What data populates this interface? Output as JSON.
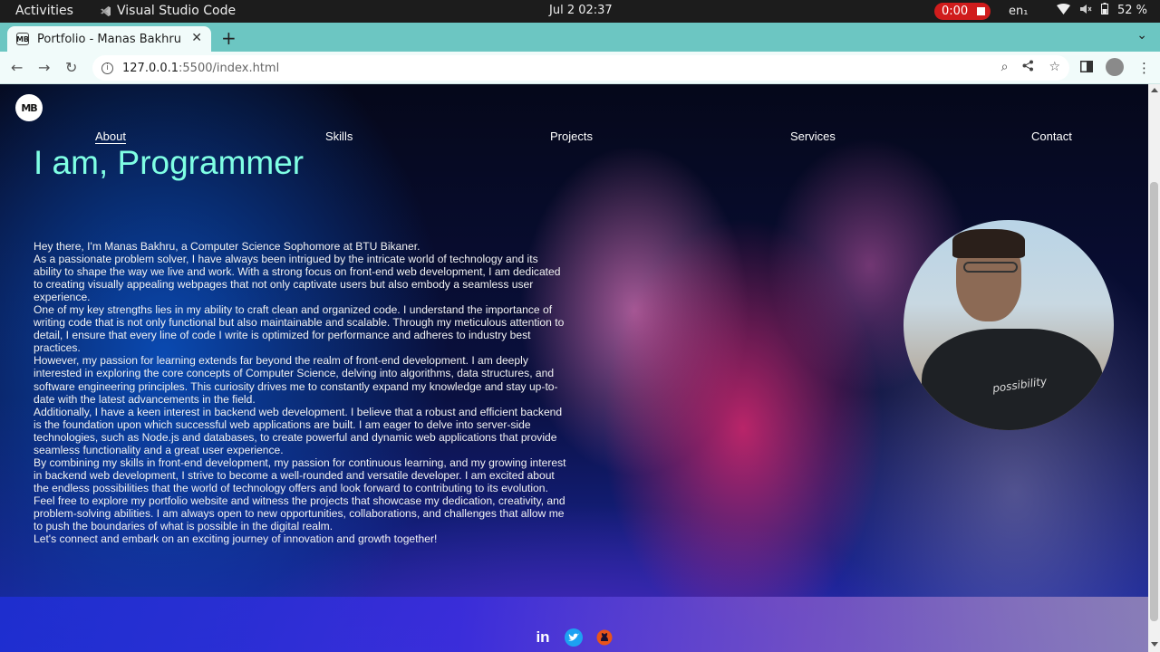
{
  "os_bar": {
    "activities": "Activities",
    "app_name": "Visual Studio Code",
    "clock": "Jul 2  02:37",
    "recording_time": "0:00",
    "language": "en₁",
    "battery": "52 %"
  },
  "browser": {
    "tab_title": "Portfolio - Manas Bakhru",
    "new_tab": "+",
    "url_host": "127.0.0.1",
    "url_rest": ":5500/index.html"
  },
  "page": {
    "logo_text": "MB",
    "nav": [
      "About",
      "Skills",
      "Projects",
      "Services",
      "Contact"
    ],
    "active_nav": "About",
    "hero_title": "I am, Programmer",
    "bio": [
      "Hey there, I'm Manas Bakhru, a Computer Science Sophomore at BTU Bikaner.",
      "As a passionate problem solver, I have always been intrigued by the intricate world of technology and its ability to shape the way we live and work. With a strong focus on front-end web development, I am dedicated to creating visually appealing webpages that not only captivate users but also embody a seamless user experience.",
      "One of my key strengths lies in my ability to craft clean and organized code. I understand the importance of writing code that is not only functional but also maintainable and scalable. Through my meticulous attention to detail, I ensure that every line of code I write is optimized for performance and adheres to industry best practices.",
      "However, my passion for learning extends far beyond the realm of front-end development. I am deeply interested in exploring the core concepts of Computer Science, delving into algorithms, data structures, and software engineering principles. This curiosity drives me to constantly expand my knowledge and stay up-to-date with the latest advancements in the field.",
      "Additionally, I have a keen interest in backend web development. I believe that a robust and efficient backend is the foundation upon which successful web applications are built. I am eager to delve into server-side technologies, such as Node.js and databases, to create powerful and dynamic web applications that provide seamless functionality and a great user experience.",
      "By combining my skills in front-end development, my passion for continuous learning, and my growing interest in backend web development, I strive to become a well-rounded and versatile developer. I am excited about the endless possibilities that the world of technology offers and look forward to contributing to its evolution.",
      "Feel free to explore my portfolio website and witness the projects that showcase my dedication, creativity, and problem-solving abilities. I am always open to new opportunities, collaborations, and challenges that allow me to push the boundaries of what is possible in the digital realm.",
      "Let's connect and embark on an exciting journey of innovation and growth together!"
    ],
    "portrait_shirt_text": "possibility",
    "social": [
      "linkedin-icon",
      "twitter-icon",
      "github-icon"
    ]
  },
  "colors": {
    "title_accent": "#7fffe4",
    "tab_strip": "#6cc6c2",
    "record_red": "#d01c1c"
  }
}
